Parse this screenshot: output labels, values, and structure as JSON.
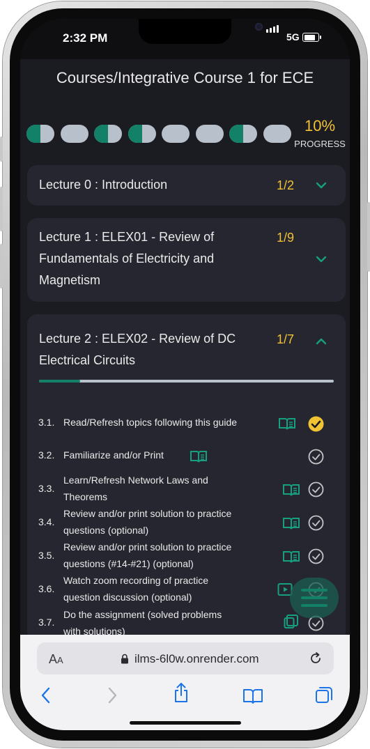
{
  "status_bar": {
    "time": "2:32 PM",
    "network": "5G"
  },
  "page": {
    "title": "Courses/Integrative Course 1 for ECE",
    "progress_percent": "10%",
    "progress_label": "PROGRESS",
    "progress_dots": [
      {
        "state": "half"
      },
      {
        "state": "empty"
      },
      {
        "state": "half"
      },
      {
        "state": "half"
      },
      {
        "state": "empty"
      },
      {
        "state": "empty"
      },
      {
        "state": "half"
      },
      {
        "state": "empty"
      }
    ]
  },
  "lectures": [
    {
      "title": "Lecture 0 : Introduction",
      "count": "1/2",
      "expanded": false
    },
    {
      "title_lines": [
        "Lecture 1 : ELEX01 - Review of",
        "Fundamentals of Electricity and",
        "Magnetism"
      ],
      "count": "1/9",
      "expanded": false
    },
    {
      "title_lines": [
        "Lecture 2 : ELEX02 - Review of DC",
        "Electrical Circuits"
      ],
      "count": "1/7",
      "expanded": true,
      "section_progress": 0.14
    }
  ],
  "items": [
    {
      "num": "3.1.",
      "lines": [
        "Read/Refresh topics following this guide"
      ],
      "icon": "book-icon",
      "done": true
    },
    {
      "num": "3.2.",
      "lines": [
        "Familiarize and/or Print"
      ],
      "icon": "book-icon",
      "done": false
    },
    {
      "num": "3.3.",
      "lines": [
        "Learn/Refresh Network Laws and",
        "Theorems"
      ],
      "icon": "book-icon",
      "done": false
    },
    {
      "num": "3.4.",
      "lines": [
        "Review and/or print solution to practice",
        "questions (optional)"
      ],
      "icon": "book-icon",
      "done": false
    },
    {
      "num": "3.5.",
      "lines": [
        "Review and/or print solution to practice",
        "questions (#14-#21) (optional)"
      ],
      "icon": "book-icon",
      "done": false
    },
    {
      "num": "3.6.",
      "lines": [
        "Watch zoom recording of practice",
        "question discussion (optional)"
      ],
      "icon": "video-icon",
      "done": false
    },
    {
      "num": "3.7.",
      "lines": [
        "Do the assignment (solved problems",
        "with solutions)"
      ],
      "icon": "assignment-icon",
      "done": false
    }
  ],
  "safari": {
    "aa_label_big": "A",
    "aa_label_small": "A",
    "url": "ilms-6l0w.onrender.com"
  },
  "colors": {
    "accent_green": "#138068",
    "accent_yellow": "#f1c233",
    "background": "#1b1b22",
    "card": "#262630"
  }
}
